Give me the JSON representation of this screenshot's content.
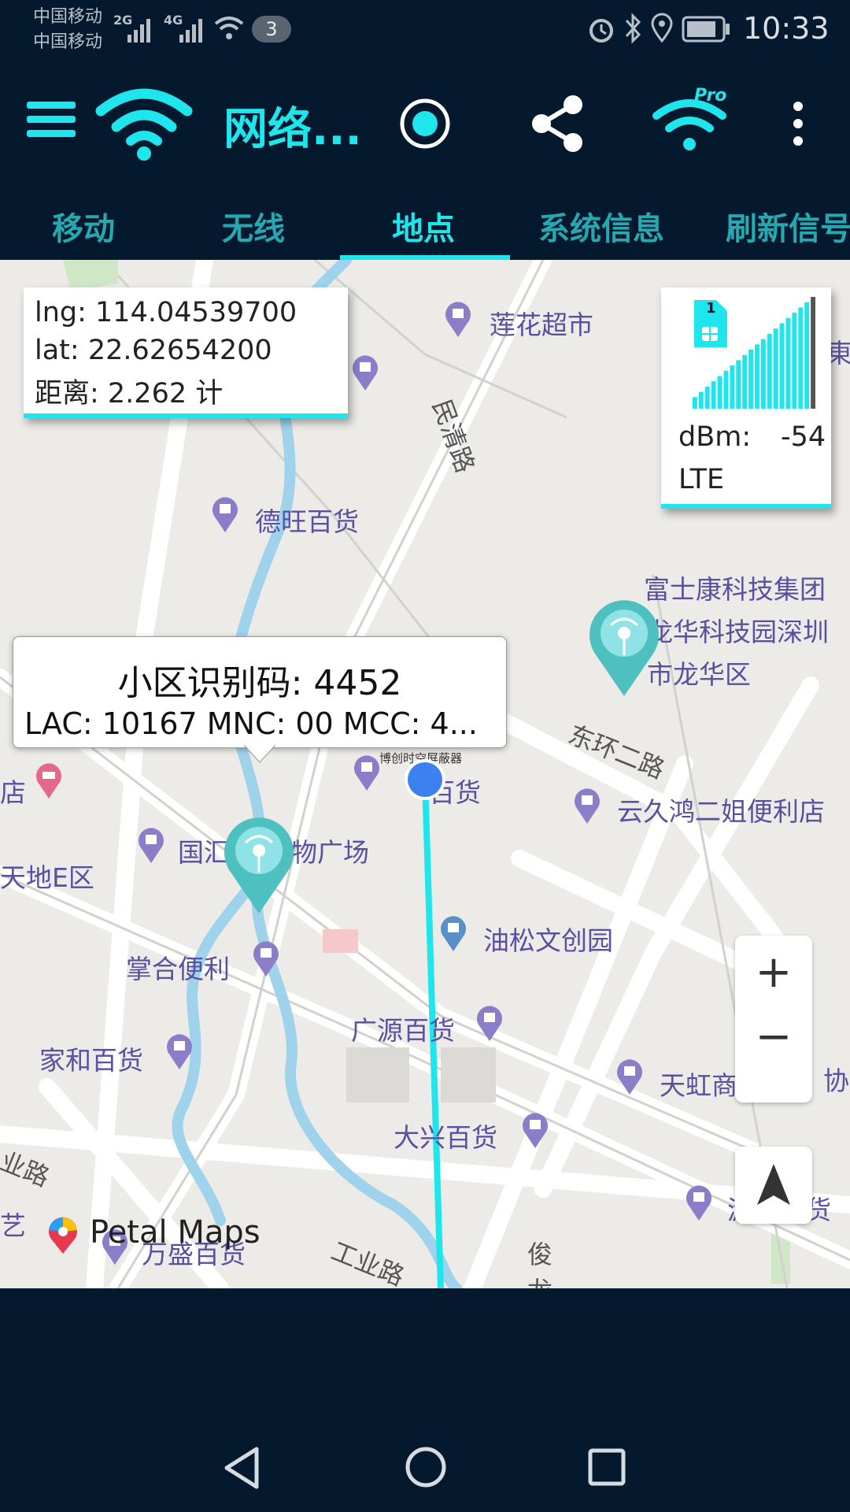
{
  "status_bar": {
    "carrier_1": "中国移动",
    "carrier_2": "中国移动",
    "net_1": "2G",
    "net_2": "4G",
    "notif_count": "3",
    "time": "10:33"
  },
  "app_bar": {
    "title": "网络...",
    "icons": [
      "menu-icon",
      "wifi-icon",
      "record-icon",
      "share-icon",
      "wifi-pro-icon",
      "more-icon"
    ],
    "pro_badge": "Pro",
    "accent": "#1fe6ec",
    "bg": "#05192e"
  },
  "tabs": [
    {
      "label": "移动",
      "active": false
    },
    {
      "label": "无线",
      "active": false
    },
    {
      "label": "地点",
      "active": true
    },
    {
      "label": "系统信息",
      "active": false
    },
    {
      "label": "刷新信号",
      "active": false
    }
  ],
  "coord_card": {
    "lng": "lng: 114.04539700",
    "lat": "lat: 22.62654200",
    "distance": "距离:   2.262 计"
  },
  "signal_card": {
    "sim": "1",
    "dbm_label": "dBm:",
    "dbm_value": "-54",
    "network": "LTE",
    "level": 1.0
  },
  "cell_bubble": {
    "line1": "小区识别码:   4452",
    "line2": "LAC: 10167 MNC: 00 MCC: 4..."
  },
  "map": {
    "pois": [
      "莲花超市",
      "德旺百货",
      "富士康科技集团",
      "龙华科技园深圳",
      "市龙华区",
      "云久鸿二姐便利店",
      "国汇",
      "物广场",
      "油松文创园",
      "掌合便利",
      "广源百货",
      "家和百货",
      "天虹商场",
      "大兴百货",
      "万盛百货",
      "源丰百货",
      "博创时空屏蔽器",
      "百货",
      "店",
      "天地E区",
      "协",
      "艺",
      "東"
    ],
    "roads": [
      "民清路",
      "东环二路",
      "工业路",
      "业路",
      "俊龙"
    ],
    "brand": "Petal Maps",
    "zoom_in": "+",
    "zoom_out": "−"
  },
  "nav_bar": {
    "icons": [
      "back-icon",
      "home-icon",
      "recents-icon"
    ]
  }
}
